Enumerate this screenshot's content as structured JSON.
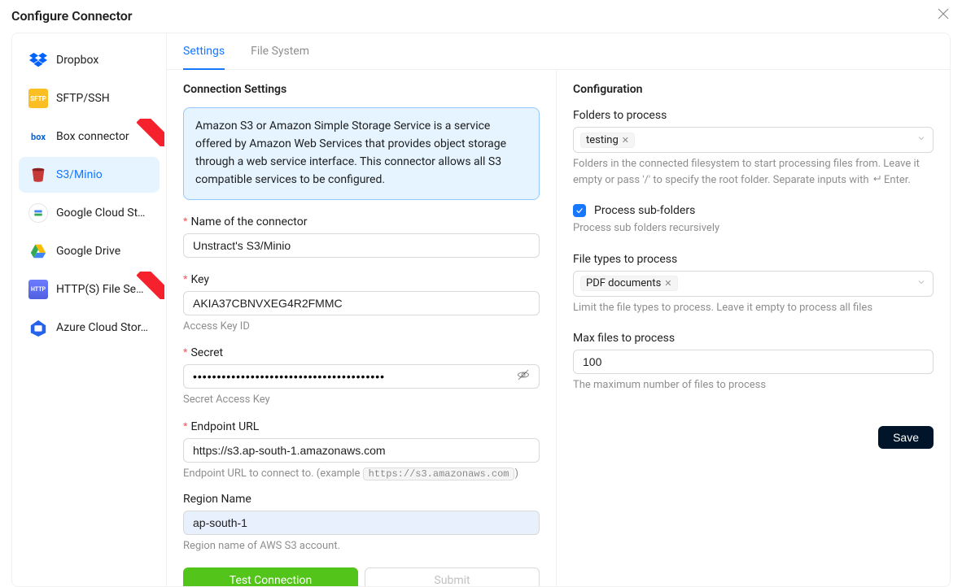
{
  "title": "Configure Connector",
  "connectors": [
    {
      "id": "dropbox",
      "label": "Dropbox"
    },
    {
      "id": "sftp",
      "label": "SFTP/SSH"
    },
    {
      "id": "box",
      "label": "Box connector",
      "ribbon": true
    },
    {
      "id": "s3",
      "label": "S3/Minio",
      "active": true
    },
    {
      "id": "gcs",
      "label": "Google Cloud Sto…"
    },
    {
      "id": "gdrive",
      "label": "Google Drive"
    },
    {
      "id": "http",
      "label": "HTTP(S) File Se…",
      "ribbon": true
    },
    {
      "id": "azure",
      "label": "Azure Cloud Stor…"
    }
  ],
  "tabs": {
    "settings": "Settings",
    "filesystem": "File System"
  },
  "connection": {
    "heading": "Connection Settings",
    "info": "Amazon S3 or Amazon Simple Storage Service is a service offered by Amazon Web Services that provides object storage through a web service interface. This connector allows all S3 compatible services to be configured.",
    "name_label": "Name of the connector",
    "name_value": "Unstract's S3/Minio",
    "key_label": "Key",
    "key_value": "AKIA37CBNVXEG4R2FMMC",
    "key_help": "Access Key ID",
    "secret_label": "Secret",
    "secret_value": "••••••••••••••••••••••••••••••••••••••••",
    "secret_help": "Secret Access Key",
    "endpoint_label": "Endpoint URL",
    "endpoint_value": "https://s3.ap-south-1.amazonaws.com",
    "endpoint_help_pre": "Endpoint URL to connect to. (example ",
    "endpoint_help_code": "https://s3.amazonaws.com",
    "endpoint_help_post": ")",
    "region_label": "Region Name",
    "region_value": "ap-south-1",
    "region_help": "Region name of AWS S3 account.",
    "test_button": "Test Connection",
    "submit_button": "Submit"
  },
  "config": {
    "heading": "Configuration",
    "folders_label": "Folders to process",
    "folders_tag": "testing",
    "folders_help_pre": "Folders in the connected filesystem to start processing files from. Leave it empty or pass '/' to specify the root folder. Separate inputs with ",
    "folders_help_post": " Enter.",
    "subfolders_label": "Process sub-folders",
    "subfolders_help": "Process sub folders recursively",
    "filetypes_label": "File types to process",
    "filetypes_tag": "PDF documents",
    "filetypes_help": "Limit the file types to process. Leave it empty to process all files",
    "maxfiles_label": "Max files to process",
    "maxfiles_value": "100",
    "maxfiles_help": "The maximum number of files to process",
    "save_button": "Save"
  }
}
